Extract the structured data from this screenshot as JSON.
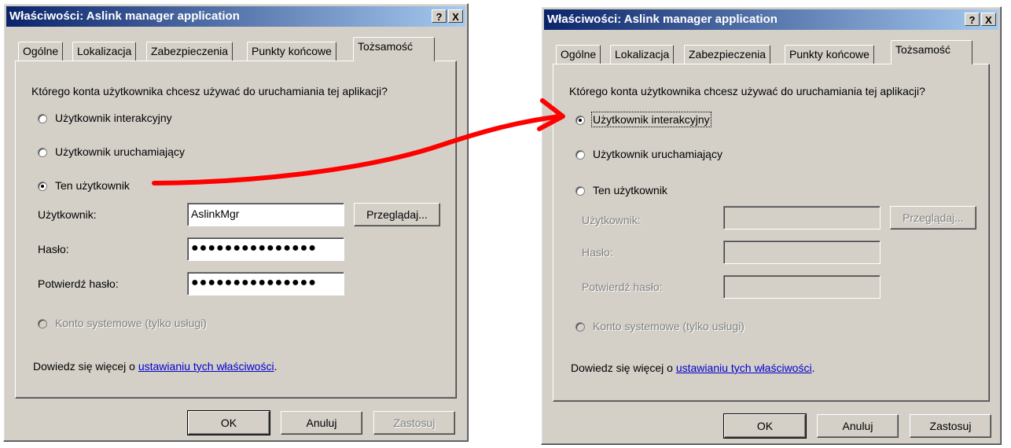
{
  "left_dialog": {
    "title": "Właściwości: Aslink manager application",
    "help_btn": "?",
    "close_btn": "X",
    "tabs": [
      "Ogólne",
      "Lokalizacja",
      "Zabezpieczenia",
      "Punkty końcowe",
      "Tożsamość"
    ],
    "question": "Którego konta użytkownika chcesz używać do uruchamiania tej aplikacji?",
    "radio_interactive": "Użytkownik interakcyjny",
    "radio_launching": "Użytkownik uruchamiający",
    "radio_this_user": "Ten użytkownik",
    "user_label": "Użytkownik:",
    "user_value": "AslinkMgr",
    "browse": "Przeglądaj...",
    "password_label": "Hasło:",
    "password_value": "●●●●●●●●●●●●●●●",
    "confirm_label": "Potwierdź hasło:",
    "confirm_value": "●●●●●●●●●●●●●●●",
    "radio_system": "Konto systemowe (tylko usługi)",
    "learn_more": "Dowiedz się więcej o ",
    "learn_link": "ustawianiu tych właściwości",
    "learn_end": ".",
    "ok": "OK",
    "cancel": "Anuluj",
    "apply": "Zastosuj"
  },
  "right_dialog": {
    "title": "Właściwości: Aslink manager application",
    "help_btn": "?",
    "close_btn": "X",
    "tabs": [
      "Ogólne",
      "Lokalizacja",
      "Zabezpieczenia",
      "Punkty końcowe",
      "Tożsamość"
    ],
    "question": "Którego konta użytkownika chcesz używać do uruchamiania tej aplikacji?",
    "radio_interactive": "Użytkownik interakcyjny",
    "radio_launching": "Użytkownik uruchamiający",
    "radio_this_user": "Ten użytkownik",
    "user_label": "Użytkownik:",
    "user_value": "",
    "browse": "Przeglądaj...",
    "password_label": "Hasło:",
    "confirm_label": "Potwierdź hasło:",
    "radio_system": "Konto systemowe (tylko usługi)",
    "learn_more": "Dowiedz się więcej o ",
    "learn_link": "ustawianiu tych właściwości",
    "learn_end": ".",
    "ok": "OK",
    "cancel": "Anuluj",
    "apply": "Zastosuj"
  },
  "colors": {
    "annotation_arrow": "#ff0000",
    "titlebar_start": "#0a246a",
    "titlebar_end": "#a6caf0",
    "link": "#0000cc"
  }
}
